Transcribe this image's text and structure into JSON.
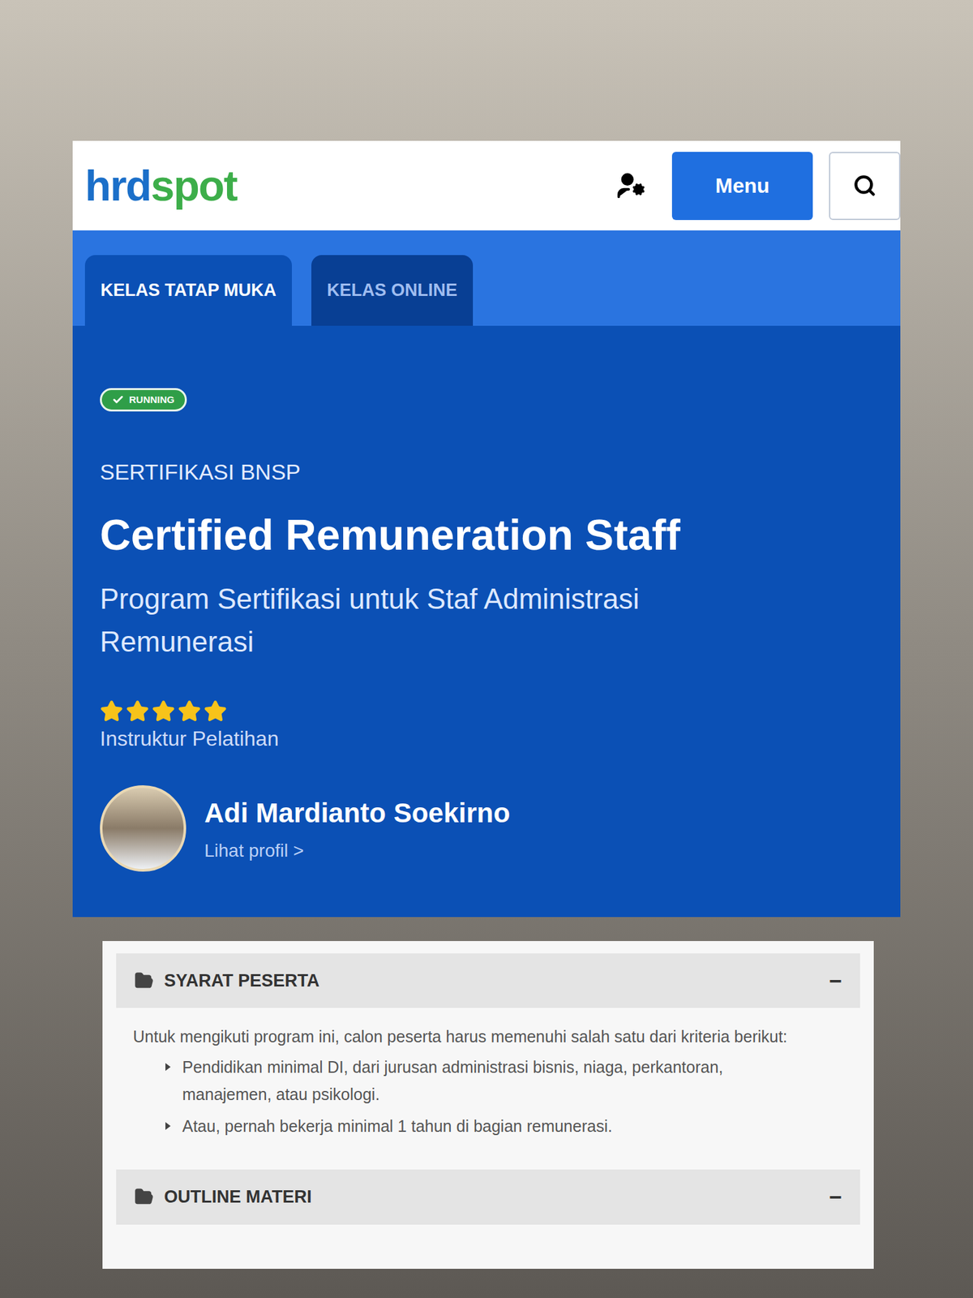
{
  "logo": {
    "part1": "hrd",
    "part2": "spot"
  },
  "header": {
    "menu_button": "Menu"
  },
  "tabs": [
    {
      "label": "KELAS TATAP MUKA",
      "selected": true
    },
    {
      "label": "KELAS ONLINE",
      "selected": false
    }
  ],
  "course": {
    "status": "RUNNING",
    "category": "SERTIFIKASI BNSP",
    "title": "Certified Remuneration Staff",
    "subtitle": "Program Sertifikasi untuk Staf Administrasi Remunerasi",
    "stars": 5,
    "instructor_label": "Instruktur Pelatihan",
    "instructor": {
      "name": "Adi Mardianto Soekirno",
      "profile_link": "Lihat profil >"
    }
  },
  "sections": [
    {
      "title": "SYARAT PESERTA",
      "toggle": "−",
      "expanded": true,
      "intro": "Untuk mengikuti program ini, calon peserta harus memenuhi salah satu dari kriteria berikut:",
      "items": [
        "Pendidikan minimal DI, dari jurusan administrasi bisnis, niaga, perkantoran, manajemen, atau psikologi.",
        "Atau, pernah bekerja minimal 1 tahun di bagian remunerasi."
      ]
    },
    {
      "title": "OUTLINE MATERI",
      "toggle": "−",
      "expanded": true,
      "intro": "",
      "items": []
    }
  ]
}
